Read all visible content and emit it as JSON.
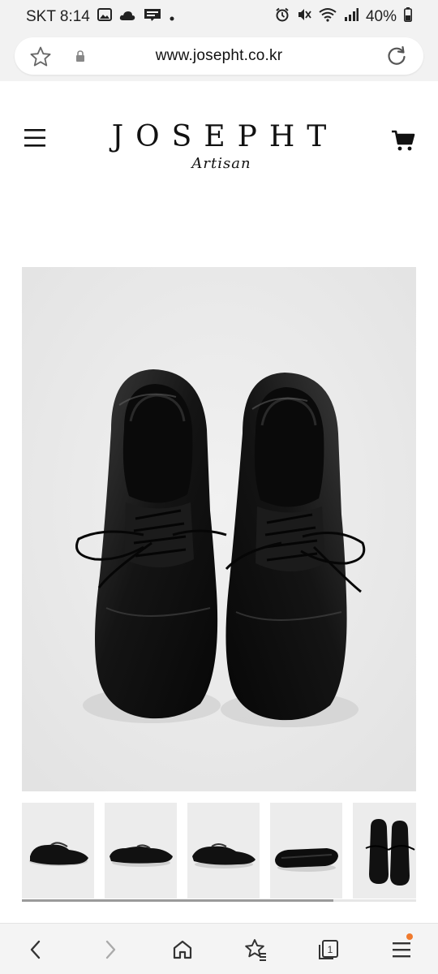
{
  "status_bar": {
    "carrier_time": "SKT 8:14",
    "battery": "40%",
    "left_icons": [
      "gallery-icon",
      "cloud-icon",
      "webtoon-icon",
      "dot-icon"
    ],
    "right_icons": [
      "alarm-icon",
      "mute-icon",
      "wifi-icon",
      "signal-icon",
      "battery-icon"
    ]
  },
  "browser": {
    "url": "www.josepht.co.kr"
  },
  "site": {
    "logo_name": "JOSEPHT",
    "logo_sub": "Artisan"
  },
  "gallery": {
    "thumbnail_count": 5,
    "scroll_position": 0.79
  },
  "bottom_nav": {
    "tab_count": "1",
    "colors": {
      "notification_dot": "#f07a2d"
    }
  }
}
